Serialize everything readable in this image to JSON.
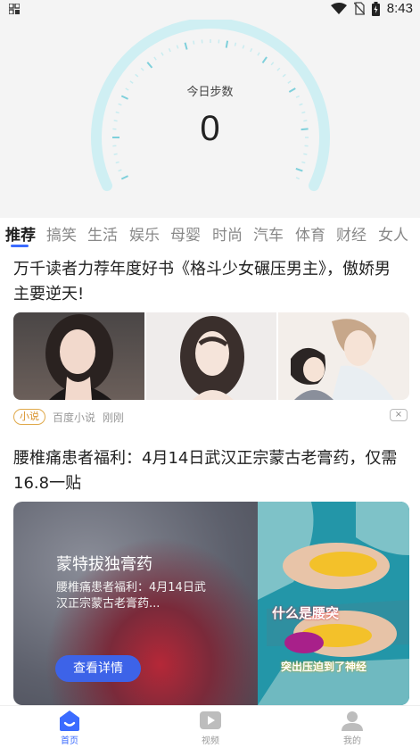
{
  "status_bar": {
    "time": "8:43"
  },
  "steps": {
    "label": "今日步数",
    "value": "0"
  },
  "tabs": [
    {
      "label": "推荐",
      "active": true
    },
    {
      "label": "搞笑"
    },
    {
      "label": "生活"
    },
    {
      "label": "娱乐"
    },
    {
      "label": "母婴"
    },
    {
      "label": "时尚"
    },
    {
      "label": "汽车"
    },
    {
      "label": "体育"
    },
    {
      "label": "财经"
    },
    {
      "label": "女人"
    }
  ],
  "feed": {
    "article1": {
      "title": "万千读者力荐年度好书《格斗少女碾压男主》，傲娇男主要逆天!",
      "tag": "小说",
      "source": "百度小说",
      "time": "刚刚",
      "dismiss": "×"
    },
    "article2": {
      "title": "腰椎痛患者福利：4月14日武汉正宗蒙古老膏药，仅需16.8一贴",
      "ad_title": "蒙特拔独膏药",
      "ad_desc": "腰椎痛患者福利：4月14日武汉正宗蒙古老膏药...",
      "ad_button": "查看详情",
      "ad_overlay_1": "什么是腰突",
      "ad_overlay_2": "突出压迫到了神经"
    }
  },
  "bottom_nav": [
    {
      "label": "首页",
      "icon": "home-icon",
      "active": true
    },
    {
      "label": "视频",
      "icon": "video-play-icon"
    },
    {
      "label": "我的",
      "icon": "profile-icon"
    }
  ],
  "colors": {
    "accent": "#3b6bff",
    "gauge": "#cfeff3",
    "tag": "#d8912a"
  }
}
